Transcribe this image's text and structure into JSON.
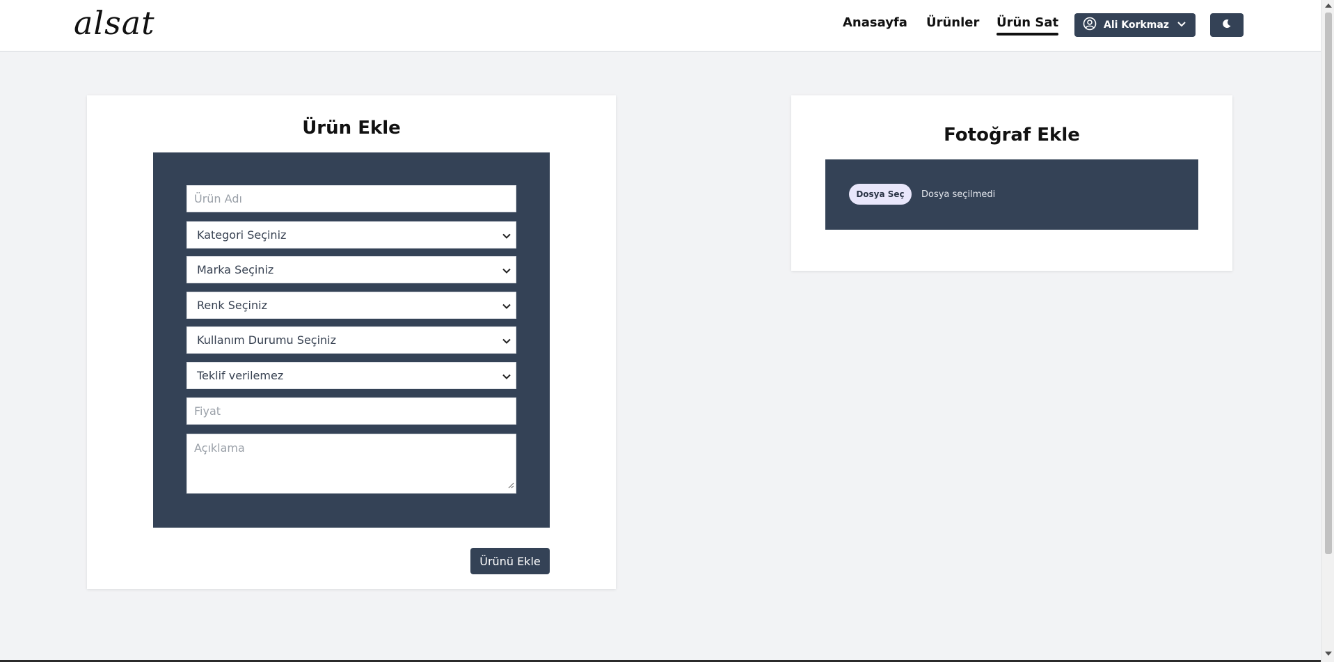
{
  "header": {
    "logo": "alsat",
    "nav": [
      {
        "label": "Anasayfa",
        "active": false
      },
      {
        "label": "Ürünler",
        "active": false
      },
      {
        "label": "Ürün Sat",
        "active": true
      }
    ],
    "user_name": "Ali Korkmaz",
    "icons": {
      "user": "user-circle-icon",
      "dropdown": "chevron-down-icon",
      "theme": "moon-icon"
    }
  },
  "product_form": {
    "title": "Ürün Ekle",
    "name_placeholder": "Ürün Adı",
    "selects": {
      "category": "Kategori Seçiniz",
      "brand": "Marka Seçiniz",
      "color": "Renk Seçiniz",
      "usage": "Kullanım Durumu Seçiniz",
      "offer": "Teklif verilemez"
    },
    "price_placeholder": "Fiyat",
    "description_placeholder": "Açıklama",
    "submit_label": "Ürünü Ekle"
  },
  "photo_form": {
    "title": "Fotoğraf Ekle",
    "choose_file_label": "Dosya Seç",
    "file_status": "Dosya seçilmedi"
  },
  "colors": {
    "panel": "#344256",
    "background": "#f2f3f5",
    "card": "#ffffff"
  }
}
